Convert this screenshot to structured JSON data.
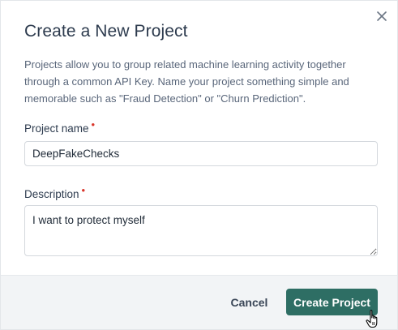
{
  "dialog": {
    "title": "Create a New Project",
    "description": "Projects allow you to group related machine learning activity together through a common API Key. Name your project something simple and memorable such as \"Fraud Detection\" or \"Churn Prediction\".",
    "close_icon": "close-icon"
  },
  "form": {
    "project_name": {
      "label": "Project name",
      "required_marker": "•",
      "value": "DeepFakeChecks"
    },
    "description": {
      "label": "Description",
      "required_marker": "•",
      "value": "I want to protect myself"
    }
  },
  "footer": {
    "cancel_label": "Cancel",
    "create_label": "Create Project"
  },
  "colors": {
    "primary": "#2e6e64",
    "required": "#d9362b",
    "title": "#2d3b4e"
  }
}
